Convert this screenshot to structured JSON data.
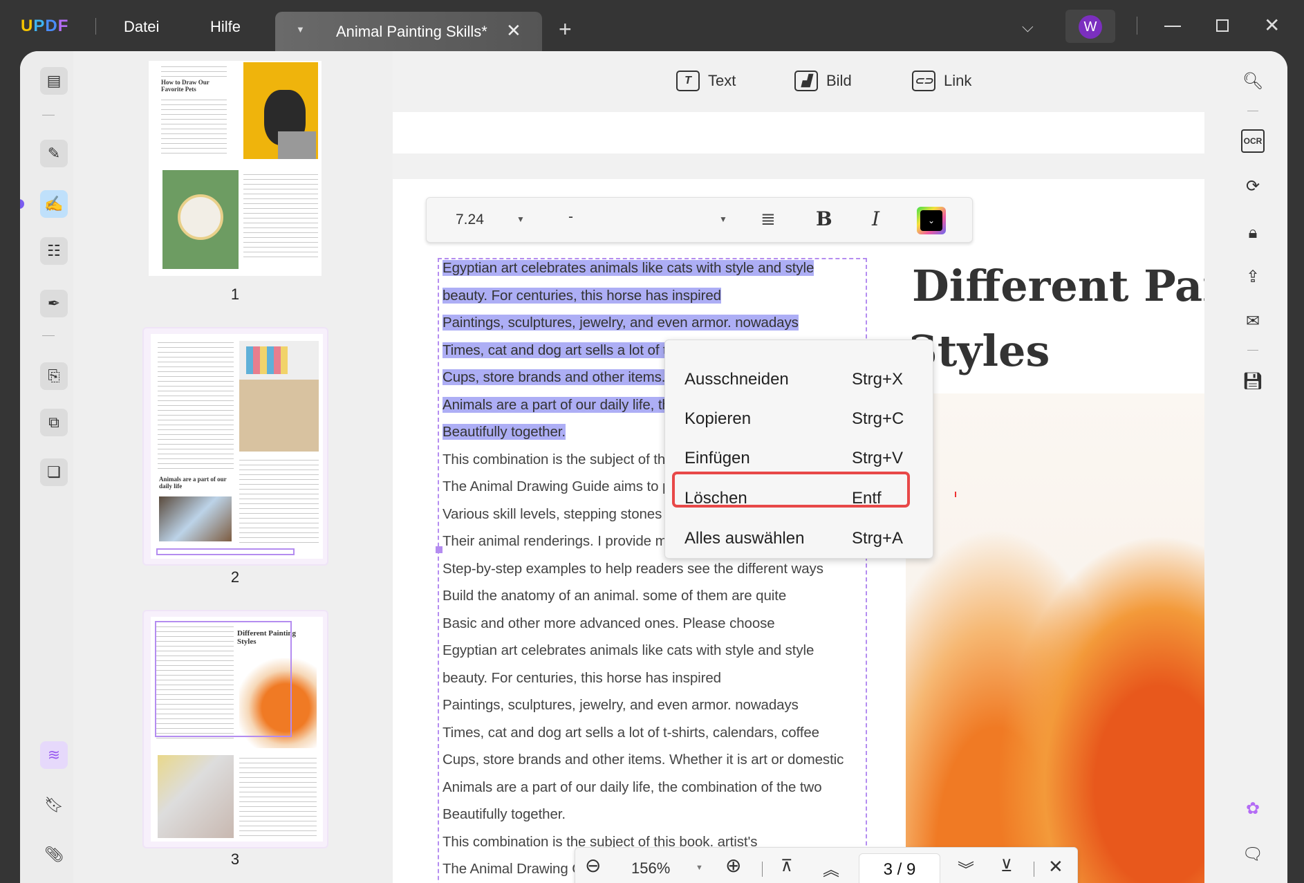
{
  "titlebar": {
    "logo": "UPDF",
    "menu": [
      "Datei",
      "Hilfe"
    ],
    "tab_title": "Animal Painting Skills*",
    "avatar": "W",
    "avatar_color": "#7b2fbf"
  },
  "toolbar": {
    "text": "Text",
    "image": "Bild",
    "link": "Link"
  },
  "edit_toolbar": {
    "font_size": "7.24",
    "font_name": "-",
    "text_color": "#000000"
  },
  "document": {
    "lines": [
      "Egyptian art celebrates animals like cats with style and style",
      "beauty. For centuries, this horse has inspired",
      "Paintings, sculptures, jewelry, and even armor. nowadays",
      "Times, cat and dog art sells a lot of t-shirts, calendars, coffee",
      "Cups, store brands and other items. Whether it is art or domestic",
      "Animals are a part of our daily life, the combination of the two",
      "Beautifully together.",
      "This combination is the subject of this book. artist's",
      "The Animal Drawing Guide aims to provide people with",
      "Various skill levels, stepping stones for improvement",
      "Their animal renderings. I provide many sketches and",
      "Step-by-step examples to help readers see the different ways",
      "Build the anatomy of an animal. some of them are quite",
      "Basic and other more advanced ones. Please choose",
      "Egyptian art celebrates animals like cats with style and style",
      "beauty. For centuries, this horse has inspired",
      "Paintings, sculptures, jewelry, and even armor. nowadays",
      "Times, cat and dog art sells a lot of t-shirts, calendars, coffee",
      "Cups, store brands and other items. Whether it is art or domestic",
      "Animals are a part of our daily life, the combination of the two",
      "Beautifully together.",
      "This combination is the subject of this book. artist's",
      "The Animal Drawing Guide aims to provide people with"
    ],
    "highlight_color": "#adaef5",
    "heading_line1": "Different Pair",
    "heading_line2": "Styles"
  },
  "context_menu": [
    {
      "label": "Ausschneiden",
      "shortcut": "Strg+X"
    },
    {
      "label": "Kopieren",
      "shortcut": "Strg+C"
    },
    {
      "label": "Einfügen",
      "shortcut": "Strg+V"
    },
    {
      "label": "Löschen",
      "shortcut": "Entf",
      "highlighted": true
    },
    {
      "label": "Alles auswählen",
      "shortcut": "Strg+A"
    }
  ],
  "thumbnails": [
    {
      "page": "1",
      "title": "How to Draw Our Favorite Pets"
    },
    {
      "page": "2",
      "title": "Animals are a part of our daily life"
    },
    {
      "page": "3",
      "title": "Different Painting Styles"
    }
  ],
  "bottom_bar": {
    "zoom": "156%",
    "current_page": "3",
    "total_pages": "9",
    "separator": "/"
  }
}
